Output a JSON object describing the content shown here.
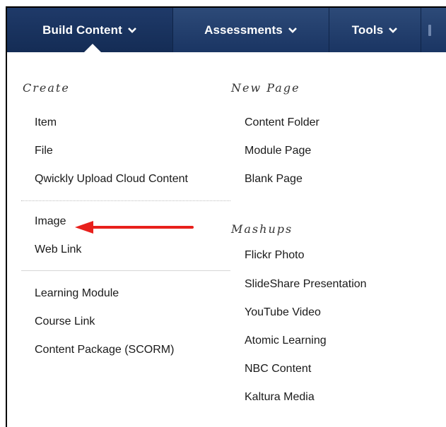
{
  "nav": {
    "tabs": [
      {
        "label": "Build Content",
        "active": true
      },
      {
        "label": "Assessments"
      },
      {
        "label": "Tools"
      }
    ],
    "chevron_icon": "chevron-down-icon"
  },
  "menu": {
    "create": {
      "heading": "Create",
      "group1": [
        "Item",
        "File",
        "Qwickly Upload Cloud Content"
      ],
      "group2": [
        "Image",
        "Web Link"
      ],
      "group3": [
        "Learning Module",
        "Course Link",
        "Content Package (SCORM)"
      ]
    },
    "new_page": {
      "heading": "New Page",
      "items": [
        "Content Folder",
        "Module Page",
        "Blank Page"
      ]
    },
    "mashups": {
      "heading": "Mashups",
      "items": [
        "Flickr Photo",
        "SlideShare Presentation",
        "YouTube Video",
        "Atomic Learning",
        "NBC Content",
        "Kaltura Media"
      ]
    }
  },
  "annotation": {
    "arrow_color": "#e8201c",
    "arrow_icon": "red-arrow-left-icon"
  },
  "colors": {
    "nav_bg": "#1f3a69",
    "nav_text": "#ffffff"
  }
}
